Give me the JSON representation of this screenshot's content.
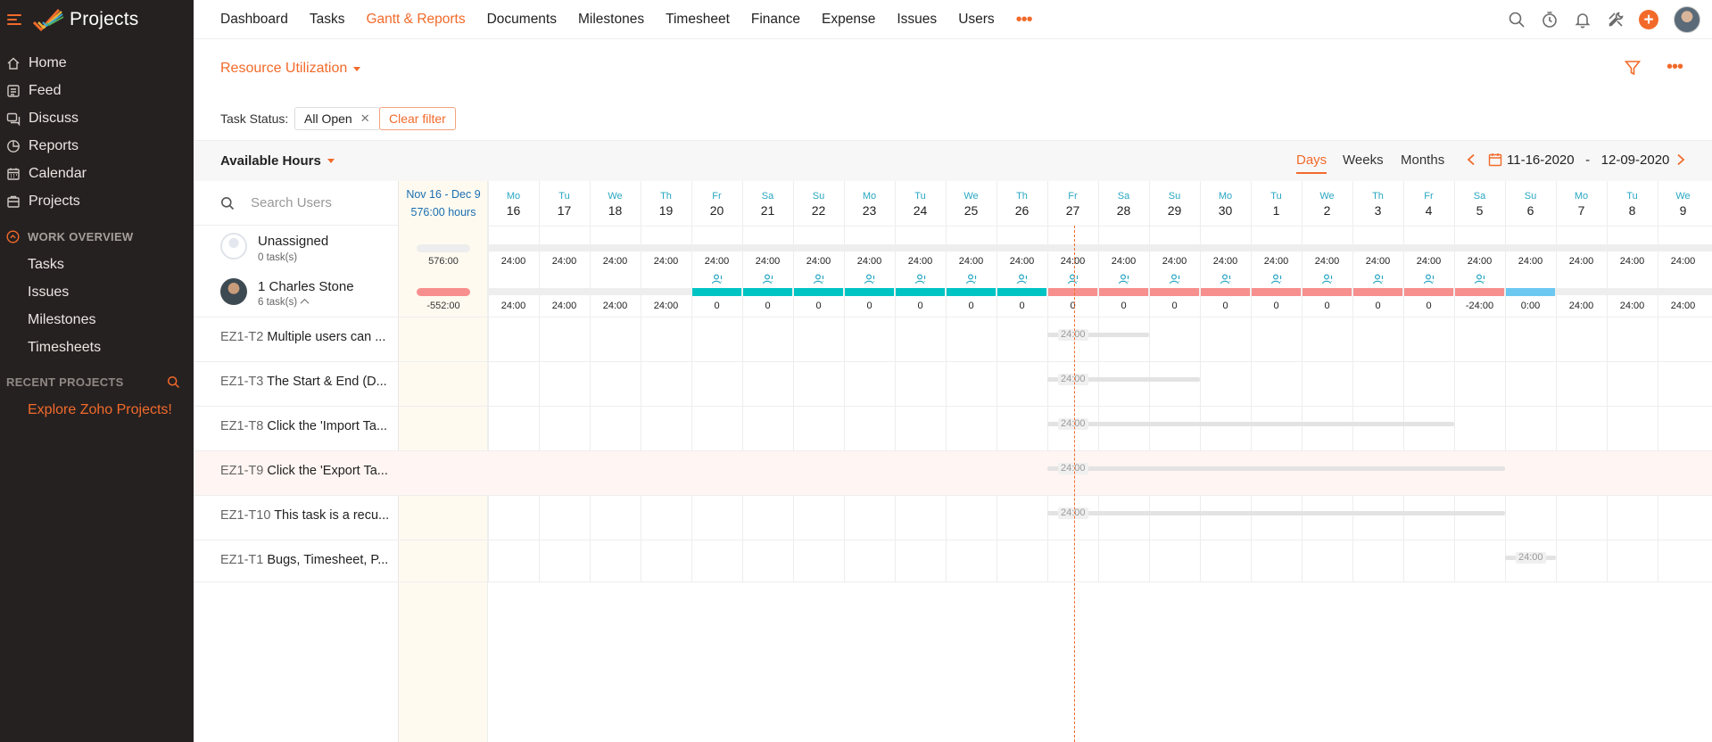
{
  "app": {
    "name": "Projects",
    "colors": {
      "accent": "#f26a2a",
      "teal": "#00c4c4",
      "over": "#f78f8f",
      "partial": "#6cc8f0",
      "link": "#1a6fb0"
    }
  },
  "sidebar": {
    "items": [
      {
        "label": "Home",
        "icon": "home-icon"
      },
      {
        "label": "Feed",
        "icon": "feed-icon"
      },
      {
        "label": "Discuss",
        "icon": "discuss-icon"
      },
      {
        "label": "Reports",
        "icon": "reports-icon"
      },
      {
        "label": "Calendar",
        "icon": "calendar-icon"
      },
      {
        "label": "Projects",
        "icon": "projects-icon"
      }
    ],
    "work_overview": {
      "title": "WORK OVERVIEW",
      "items": [
        "Tasks",
        "Issues",
        "Milestones",
        "Timesheets"
      ]
    },
    "recent_projects": {
      "title": "RECENT PROJECTS",
      "explore": "Explore Zoho Projects!"
    }
  },
  "topnav": {
    "tabs": [
      "Dashboard",
      "Tasks",
      "Gantt & Reports",
      "Documents",
      "Milestones",
      "Timesheet",
      "Finance",
      "Expense",
      "Issues",
      "Users"
    ],
    "active_tab": "Gantt & Reports",
    "more": "•••",
    "icons": [
      "search-icon",
      "timer-icon",
      "bell-icon",
      "tools-icon"
    ],
    "plus": "+"
  },
  "view": {
    "title": "Resource Utilization",
    "more": "•••",
    "filter_label": "Task Status:",
    "filter_value": "All Open",
    "filter_remove": "✕",
    "clear_filter": "Clear filter"
  },
  "toolbar": {
    "metric": "Available Hours",
    "segments": [
      "Days",
      "Weeks",
      "Months"
    ],
    "active_segment": "Days",
    "range_start": "11-16-2020",
    "range_sep": "-",
    "range_end": "12-09-2020"
  },
  "grid": {
    "search_placeholder": "Search Users",
    "summary": {
      "range": "Nov 16 - Dec 9",
      "hours": "576:00 hours"
    },
    "days": [
      {
        "n": "Mo",
        "d": "16"
      },
      {
        "n": "Tu",
        "d": "17"
      },
      {
        "n": "We",
        "d": "18"
      },
      {
        "n": "Th",
        "d": "19"
      },
      {
        "n": "Fr",
        "d": "20"
      },
      {
        "n": "Sa",
        "d": "21"
      },
      {
        "n": "Su",
        "d": "22"
      },
      {
        "n": "Mo",
        "d": "23"
      },
      {
        "n": "Tu",
        "d": "24"
      },
      {
        "n": "We",
        "d": "25"
      },
      {
        "n": "Th",
        "d": "26"
      },
      {
        "n": "Fr",
        "d": "27"
      },
      {
        "n": "Sa",
        "d": "28"
      },
      {
        "n": "Su",
        "d": "29"
      },
      {
        "n": "Mo",
        "d": "30"
      },
      {
        "n": "Tu",
        "d": "1"
      },
      {
        "n": "We",
        "d": "2"
      },
      {
        "n": "Th",
        "d": "3"
      },
      {
        "n": "Fr",
        "d": "4"
      },
      {
        "n": "Sa",
        "d": "5"
      },
      {
        "n": "Su",
        "d": "6"
      },
      {
        "n": "Mo",
        "d": "7"
      },
      {
        "n": "Tu",
        "d": "8"
      },
      {
        "n": "We",
        "d": "9"
      }
    ],
    "users": [
      {
        "name": "Unassigned",
        "tasks": "0 task(s)",
        "summary": "576:00",
        "values": [
          "24:00",
          "24:00",
          "24:00",
          "24:00",
          "24:00",
          "24:00",
          "24:00",
          "24:00",
          "24:00",
          "24:00",
          "24:00",
          "24:00",
          "24:00",
          "24:00",
          "24:00",
          "24:00",
          "24:00",
          "24:00",
          "24:00",
          "24:00",
          "24:00",
          "24:00",
          "24:00",
          "24:00"
        ]
      },
      {
        "name": "Charles Stone",
        "index": "1",
        "tasks": "6 task(s)",
        "summary": "-552:00",
        "values": [
          "24:00",
          "24:00",
          "24:00",
          "24:00",
          "0",
          "0",
          "0",
          "0",
          "0",
          "0",
          "0",
          "0",
          "0",
          "0",
          "0",
          "0",
          "0",
          "0",
          "0",
          "-24:00",
          "0:00",
          "24:00",
          "24:00",
          "24:00"
        ],
        "bars": [
          "",
          "",
          "",
          "",
          "full",
          "full",
          "full",
          "full",
          "full",
          "full",
          "full",
          "over",
          "over",
          "over",
          "over",
          "over",
          "over",
          "over",
          "over",
          "over",
          "partial",
          "",
          "",
          ""
        ]
      }
    ],
    "tasks": [
      {
        "id": "EZ1-T2",
        "title": "Multiple users can ...",
        "hours": "24:00",
        "start": 11,
        "end": 13
      },
      {
        "id": "EZ1-T3",
        "title": "The Start & End (D...",
        "hours": "24:00",
        "start": 11,
        "end": 14
      },
      {
        "id": "EZ1-T8",
        "title": "Click the 'Import Ta...",
        "hours": "24:00",
        "start": 11,
        "end": 19
      },
      {
        "id": "EZ1-T9",
        "title": "Click the 'Export Ta...",
        "hours": "24:00",
        "start": 11,
        "end": 20
      },
      {
        "id": "EZ1-T10",
        "title": "This task is a recu...",
        "hours": "24:00",
        "start": 11,
        "end": 20
      },
      {
        "id": "EZ1-T1",
        "title": "Bugs, Timesheet, P...",
        "hours": "24:00",
        "start": 20,
        "end": 21
      }
    ]
  }
}
